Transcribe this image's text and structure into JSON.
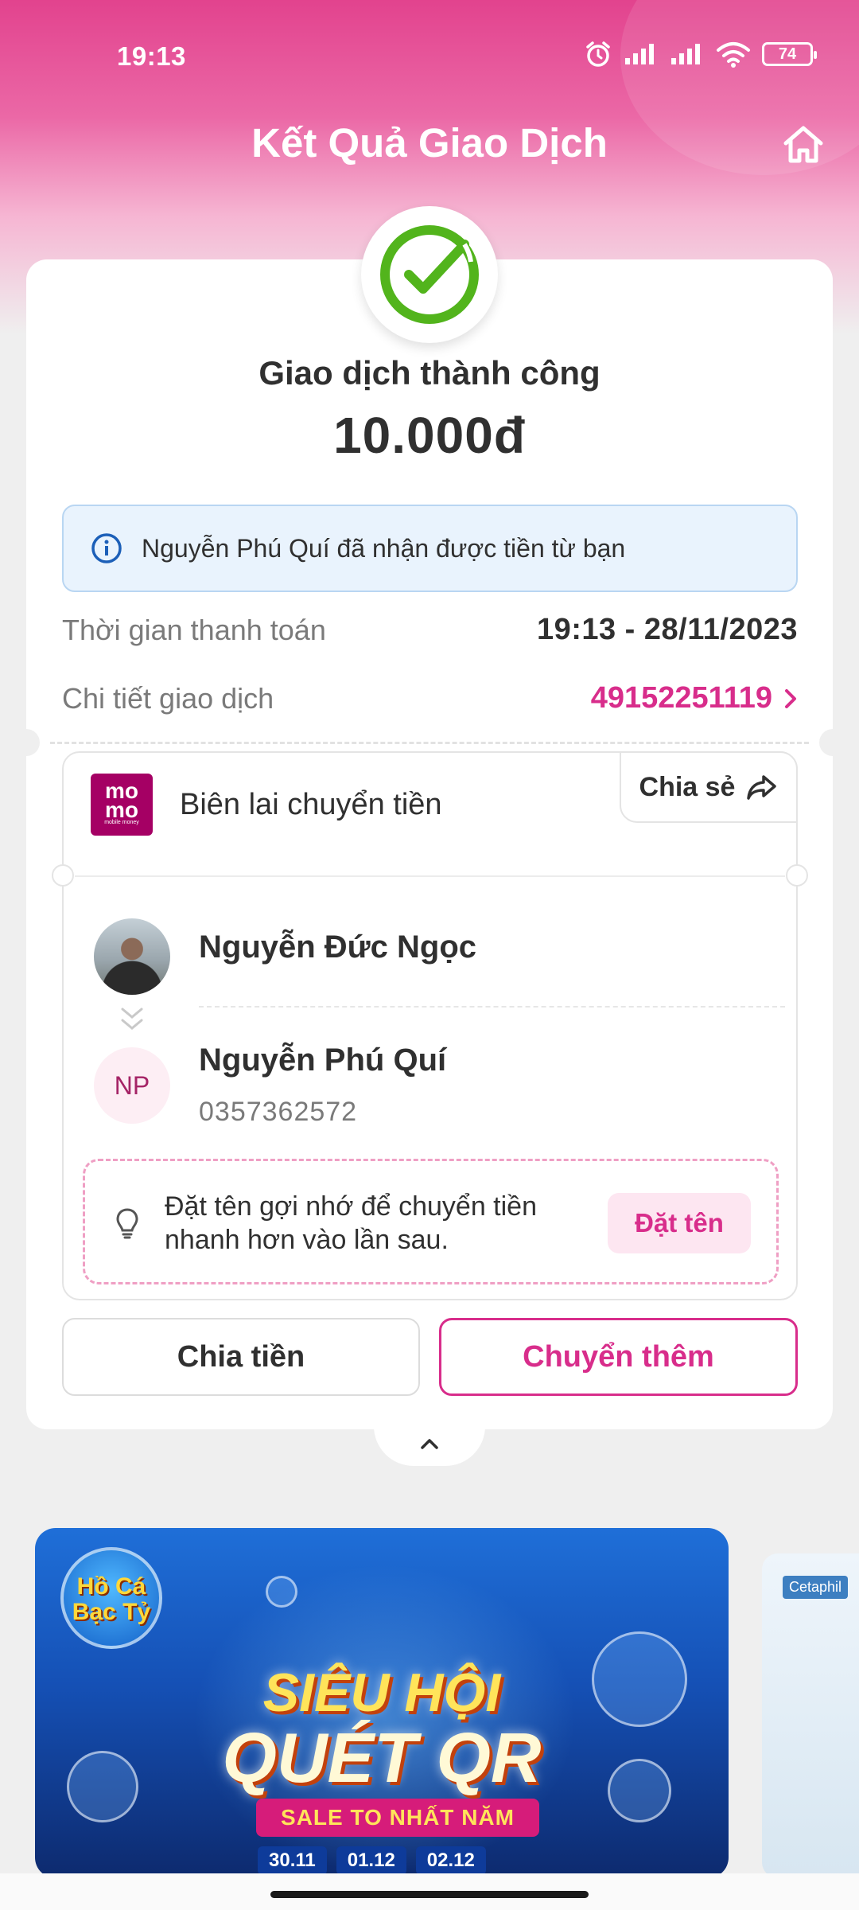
{
  "status_bar": {
    "time": "19:13",
    "battery": "74"
  },
  "header": {
    "title": "Kết Quả Giao Dịch"
  },
  "result": {
    "status": "Giao dịch thành công",
    "amount": "10.000đ"
  },
  "info": {
    "message": "Nguyễn Phú Quí đã nhận được tiền từ bạn"
  },
  "details": {
    "payment_time_label": "Thời gian thanh toán",
    "payment_time_value": "19:13 - 28/11/2023",
    "transaction_label": "Chi tiết giao dịch",
    "transaction_id": "49152251119"
  },
  "receipt": {
    "logo_text": "mo mo",
    "logo_sub": "mobile money",
    "title": "Biên lai chuyển tiền",
    "share_label": "Chia sẻ",
    "sender_name": "Nguyễn Đức Ngọc",
    "receiver_initials": "NP",
    "receiver_name": "Nguyễn Phú Quí",
    "receiver_phone": "0357362572",
    "hint_text": "Đặt tên gợi nhớ để chuyển tiền nhanh hơn vào lần sau.",
    "name_button": "Đặt tên"
  },
  "actions": {
    "split_label": "Chia tiền",
    "more_label": "Chuyển thêm"
  },
  "banner": {
    "badge": "Hồ Cá Bạc Tỷ",
    "title_line1": "SIÊU HỘI",
    "title_line2": "QUÉT QR",
    "ribbon": "SALE TO NHẤT NĂM",
    "dates": [
      "30.11",
      "01.12",
      "02.12"
    ]
  },
  "banner2": {
    "logo": "Cetaphil"
  },
  "colors": {
    "brand": "#d82d8b",
    "success": "#52b41c",
    "info_bg": "#e9f3fd"
  }
}
